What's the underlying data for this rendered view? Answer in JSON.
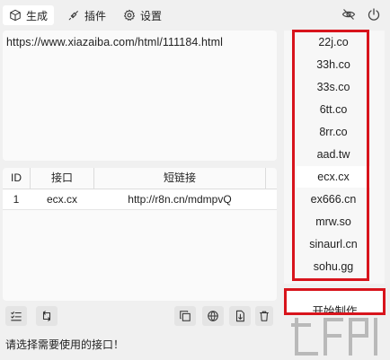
{
  "tabs": [
    {
      "label": "生成",
      "icon": "cube-icon"
    },
    {
      "label": "插件",
      "icon": "plugin-icon"
    },
    {
      "label": "设置",
      "icon": "gear-icon"
    }
  ],
  "top_right_icons": [
    "eye-off-icon",
    "power-icon"
  ],
  "url_input": {
    "value": "https://www.xiazaiba.com/html/111184.html"
  },
  "table": {
    "headers": [
      "ID",
      "接口",
      "短链接"
    ],
    "rows": [
      {
        "id": "1",
        "api": "ecx.cx",
        "short": "http://r8n.cn/mdmpvQ"
      }
    ]
  },
  "services": [
    "22j.co",
    "33h.co",
    "33s.co",
    "6tt.co",
    "8rr.co",
    "aad.tw",
    "ecx.cx",
    "ex666.cn",
    "mrw.so",
    "sinaurl.cn",
    "sohu.gg"
  ],
  "selected_service": "ecx.cx",
  "start_button": {
    "label": "开始制作"
  },
  "toolbar_icons": [
    "list-check-icon",
    "swap-icon",
    "copy-icon",
    "globe-icon",
    "export-icon",
    "trash-icon"
  ],
  "status_text": "请选择需要使用的接口！",
  "colors": {
    "highlight_border": "#d8141c",
    "background": "#f0f0f0"
  }
}
